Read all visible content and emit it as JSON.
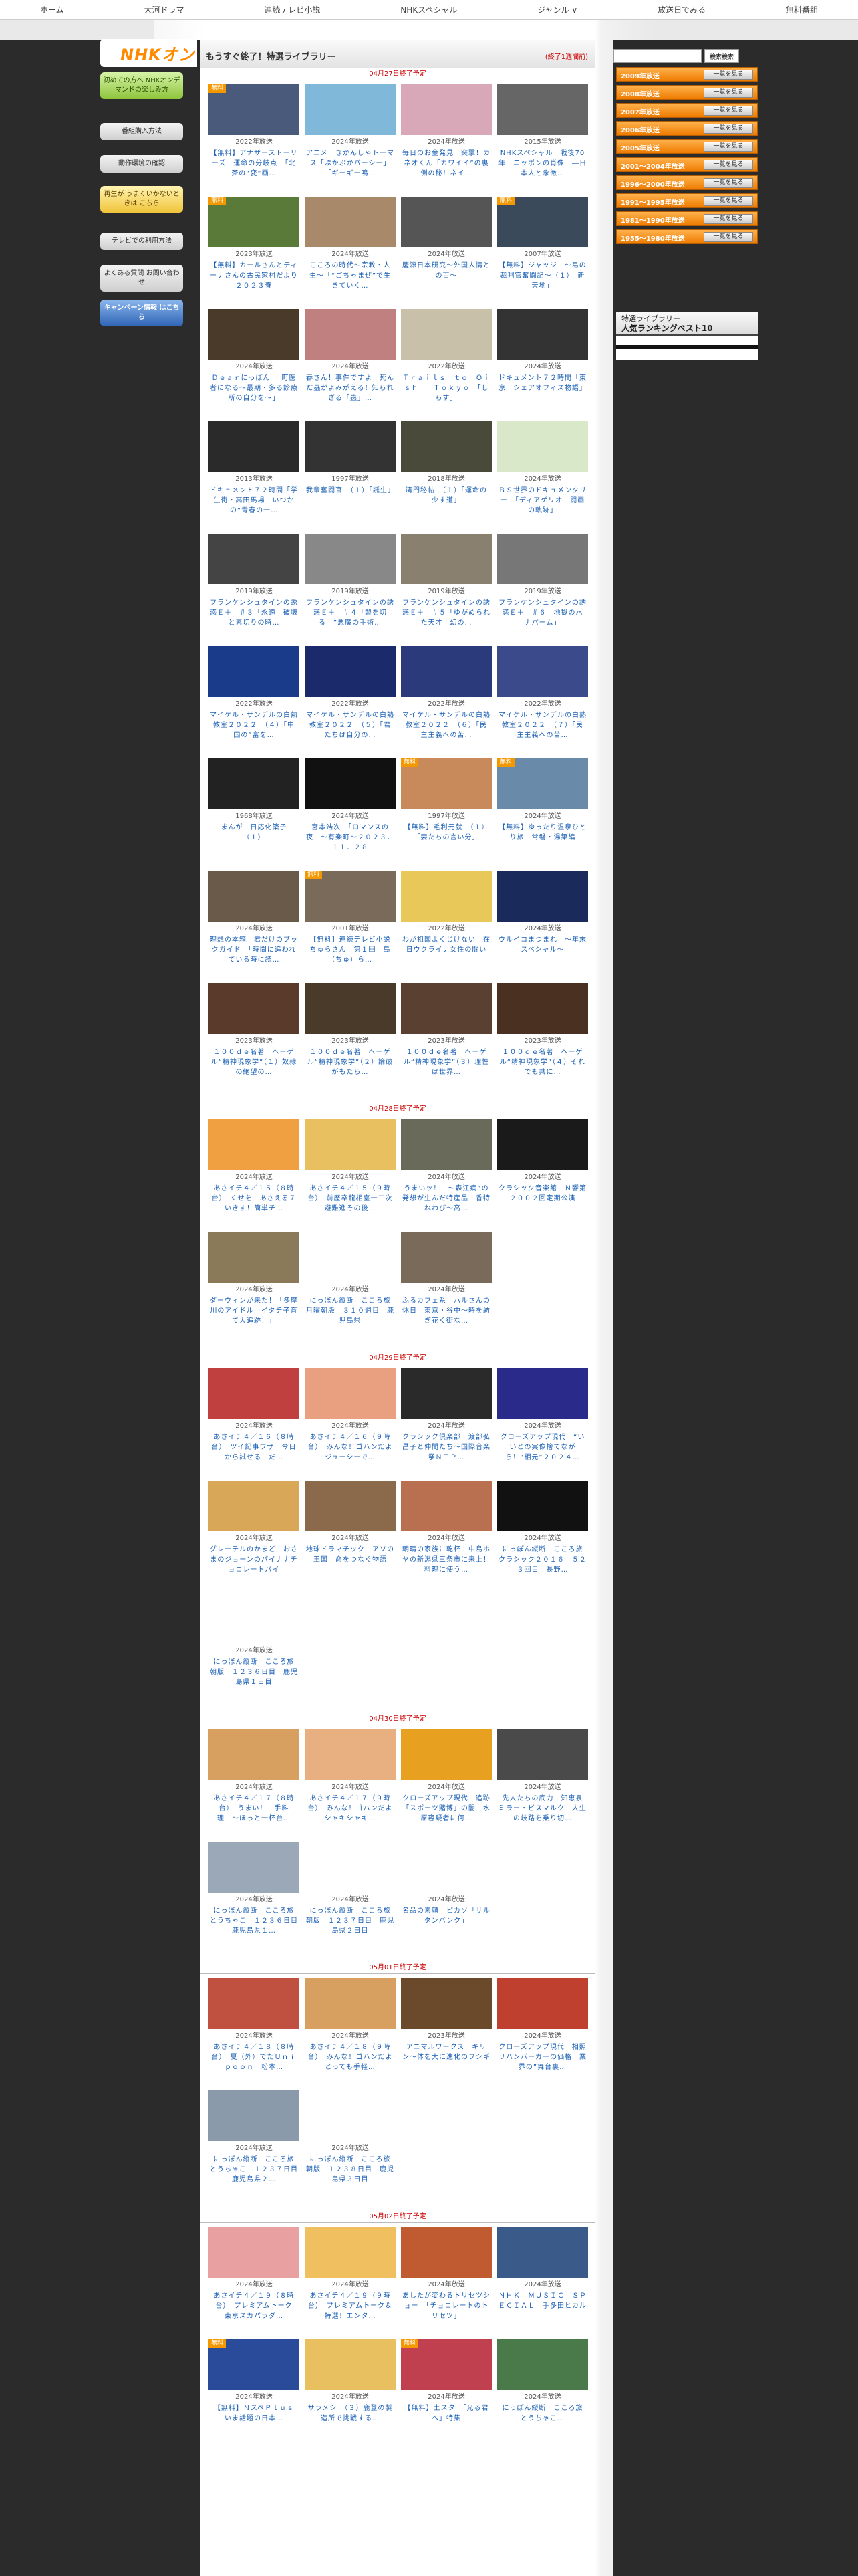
{
  "topnav": [
    "ホーム",
    "大河ドラマ",
    "連続テレビ小説",
    "NHKスペシャル",
    "ジャンル ∨",
    "放送日でみる",
    "無料番組"
  ],
  "logo": "NHKオン",
  "left_buttons": [
    "初めての方へ NHKオンデマンドの楽しみ方",
    "番組購入方法",
    "動作環境の確認",
    "再生が うまくいかないときは こちら",
    "テレビでの利用方法",
    "よくある質問 お問い合わせ",
    "キャンペーン情報 はこちら"
  ],
  "banner": {
    "title": "もうすぐ終了！特選ライブラリー",
    "note": "(終了1週間前)"
  },
  "search": {
    "placeholder": "",
    "button": "検索検索"
  },
  "years": [
    {
      "label": "2009年放送",
      "btn": "一覧を見る"
    },
    {
      "label": "2008年放送",
      "btn": "一覧を見る"
    },
    {
      "label": "2007年放送",
      "btn": "一覧を見る"
    },
    {
      "label": "2006年放送",
      "btn": "一覧を見る"
    },
    {
      "label": "2005年放送",
      "btn": "一覧を見る"
    },
    {
      "label": "2001〜2004年放送",
      "btn": "一覧を見る"
    },
    {
      "label": "1996〜2000年放送",
      "btn": "一覧を見る"
    },
    {
      "label": "1991〜1995年放送",
      "btn": "一覧を見る"
    },
    {
      "label": "1981〜1990年放送",
      "btn": "一覧を見る"
    },
    {
      "label": "1955〜1980年放送",
      "btn": "一覧を見る"
    }
  ],
  "ranking": {
    "line1": "特選ライブラリー",
    "line2": "人気ランキングベスト10"
  },
  "sections": [
    {
      "label": "04月27日終了予定",
      "items": [
        {
          "badge": "無料",
          "year": "2022年放送",
          "title": "【無料】アナザーストーリーズ　運命の分岐点　「北斎の“変”画…",
          "bg": "#4a5a7a"
        },
        {
          "badge": "",
          "year": "2024年放送",
          "title": "アニメ　きかんしゃトーマス「ぷかぷかパーシー」「ギーギー鳴…",
          "bg": "#7fb8d8"
        },
        {
          "badge": "",
          "year": "2024年放送",
          "title": "毎日のお金発見　突撃！カネオくん「カワイイ”の裏側の秘！ネイ…",
          "bg": "#d8a8b8"
        },
        {
          "badge": "",
          "year": "2015年放送",
          "title": "NHKスペシャル　戦後70年　ニッポンの肖像　―日本人と象徴…",
          "bg": "#666"
        },
        {
          "badge": "無料",
          "year": "2023年放送",
          "title": "【無料】カールさんとティーナさんの古民家村だより　２０２３春",
          "bg": "#5a7a3a"
        },
        {
          "badge": "",
          "year": "2024年放送",
          "title": "こころの時代〜宗教・人生〜「“ごちゃまぜ”で生きていく…",
          "bg": "#a88a6a"
        },
        {
          "badge": "",
          "year": "2024年放送",
          "title": "慶源日本研究〜外国人情との百〜",
          "bg": "#555"
        },
        {
          "badge": "無料",
          "year": "2007年放送",
          "title": "【無料】ジャッジ　〜島の裁判官奮闘記〜（１）「新天地」",
          "bg": "#3a4a5a"
        },
        {
          "badge": "",
          "year": "2024年放送",
          "title": "Ｄｅａｒにっぽん　「町医者になる〜最期・多る診療所の自分を〜」",
          "bg": "#4a3a2a"
        },
        {
          "badge": "",
          "year": "2024年放送",
          "title": "吞さん！事件ですよ　死んだ蟲がよみがえる！知られざる「蟲」…",
          "bg": "#c08080"
        },
        {
          "badge": "",
          "year": "2022年放送",
          "title": "Ｔｒａｉｌｓ　ｔｏ　Ｏｉｓｈｉ　Ｔｏｋｙｏ　「しらす」",
          "bg": "#c8c0a8"
        },
        {
          "badge": "",
          "year": "2024年放送",
          "title": "ドキュメント７２時間「東京　シェアオフィス物語」",
          "bg": "#333"
        },
        {
          "badge": "",
          "year": "2013年放送",
          "title": "ドキュメント７２時間「学生街・高田馬場　いつかの”青春の一…",
          "bg": "#2a2a2a"
        },
        {
          "badge": "",
          "year": "1997年放送",
          "title": "我輩奮闘官　（１）「誕生」",
          "bg": "#333"
        },
        {
          "badge": "",
          "year": "2018年放送",
          "title": "湾門秘帖　（１）「運命の少す道」",
          "bg": "#4a4a3a"
        },
        {
          "badge": "",
          "year": "2024年放送",
          "title": "ＢＳ世界のドキュメンタリー　「ディアゲリオ　闘画の軌跡」",
          "bg": "#d8e8c8"
        },
        {
          "badge": "",
          "year": "2019年放送",
          "title": "フランケンシュタインの誘惑Ｅ＋　＃３「永遠　破壊と素切りの時…",
          "bg": "#444"
        },
        {
          "badge": "",
          "year": "2019年放送",
          "title": "フランケンシュタインの誘惑Ｅ＋　＃４「製を切る　”悪魔の手術…",
          "bg": "#888"
        },
        {
          "badge": "",
          "year": "2019年放送",
          "title": "フランケンシュタインの誘惑Ｅ＋　＃５「ゆがめられた天才　幻の…",
          "bg": "#8a8070"
        },
        {
          "badge": "",
          "year": "2019年放送",
          "title": "フランケンシュタインの誘惑Ｅ＋　＃６「地獄の水　ナパーム」",
          "bg": "#777"
        },
        {
          "badge": "",
          "year": "2022年放送",
          "title": "マイケル・サンデルの白熱教室２０２２　（４）「中国の”富を…",
          "bg": "#1a3a8a"
        },
        {
          "badge": "",
          "year": "2022年放送",
          "title": "マイケル・サンデルの白熱教室２０２２　（５）「君たちは自分の…",
          "bg": "#1a2a6a"
        },
        {
          "badge": "",
          "year": "2022年放送",
          "title": "マイケル・サンデルの白熱教室２０２２　（６）「民主主義への苦…",
          "bg": "#2a3a7a"
        },
        {
          "badge": "",
          "year": "2022年放送",
          "title": "マイケル・サンデルの白熱教室２０２２　（７）「民主主義への苦…",
          "bg": "#3a4a8a"
        },
        {
          "badge": "",
          "year": "1968年放送",
          "title": "まんが　日応化簗子　（１）",
          "bg": "#222"
        },
        {
          "badge": "",
          "year": "2024年放送",
          "title": "宮本浩次　「ロマンスの夜　〜有楽町〜２０２３．１１．２８",
          "bg": "#111"
        },
        {
          "badge": "無料",
          "year": "1997年放送",
          "title": "【無料】毛利元就　（１）「妻たちの言い分」",
          "bg": "#c88a5a"
        },
        {
          "badge": "無料",
          "year": "2024年放送",
          "title": "【無料】ゆったり温泉ひとり旅　常磐・湯築編",
          "bg": "#6a8aaa"
        },
        {
          "badge": "",
          "year": "2024年放送",
          "title": "理想の本箱　君だけのブックガイド　「時間に追われている時に読…",
          "bg": "#6a5a4a"
        },
        {
          "badge": "無料",
          "year": "2001年放送",
          "title": "【無料】連続テレビ小説　ちゅらさん　第１回　島（ちゅ）ら…",
          "bg": "#7a6a5a"
        },
        {
          "badge": "",
          "year": "2022年放送",
          "title": "わが祖国よくじけない　在日ウクライナ女性の闘い",
          "bg": "#e8c858"
        },
        {
          "badge": "",
          "year": "2024年放送",
          "title": "ウルイコまつまれ　〜年末スペシャル〜",
          "bg": "#1a2a5a"
        },
        {
          "badge": "",
          "year": "2023年放送",
          "title": "１００ｄｅ名著　ヘーゲル“精神現象学”（１）奴隷の絶望の…",
          "bg": "#5a3a2a"
        },
        {
          "badge": "",
          "year": "2023年放送",
          "title": "１００ｄｅ名著　ヘーゲル“精神現象学”（２）論破がもたら…",
          "bg": "#4a3a2a"
        },
        {
          "badge": "",
          "year": "2023年放送",
          "title": "１００ｄｅ名著　ヘーゲル“精神現象学”（３）理性は世界…",
          "bg": "#5a4030"
        },
        {
          "badge": "",
          "year": "2023年放送",
          "title": "１００ｄｅ名著　ヘーゲル“精神現象学”（４）それでも共に…",
          "bg": "#4a3020"
        }
      ]
    },
    {
      "label": "04月28日終了予定",
      "items": [
        {
          "badge": "",
          "year": "2024年放送",
          "title": "あさイチ４／１５（８時台）　くせを　あさえる７いきす！簡単チ…",
          "bg": "#f0a040"
        },
        {
          "badge": "",
          "year": "2024年放送",
          "title": "あさイチ４／１５（９時台）　前歴卒龍相臺一二次避難進その後…",
          "bg": "#e8c060"
        },
        {
          "badge": "",
          "year": "2024年放送",
          "title": "うまいッ！　〜森江病”の発想が生んだ特産品！香特ねわび〜高…",
          "bg": "#6a6a5a"
        },
        {
          "badge": "",
          "year": "2024年放送",
          "title": "クラシック音楽館　Ｎ響第２００２回定期公演",
          "bg": "#1a1a1a"
        },
        {
          "badge": "",
          "year": "2024年放送",
          "title": "ダーウィンが来た！「多摩川のアイドル　イタチ子育て大追跡！」",
          "bg": "#8a7a5a"
        },
        {
          "badge": "",
          "year": "2024年放送",
          "title": "にっぽん縦断　こころ旅　月曜朝版　３１０週目　鹿児島県",
          "bg": "#ffffff"
        },
        {
          "badge": "",
          "year": "2024年放送",
          "title": "ふるカフェ系　ハルさんの休日　東京・谷中〜時を紡ぎ花く街な…",
          "bg": "#7a6a5a"
        }
      ]
    },
    {
      "label": "04月29日終了予定",
      "items": [
        {
          "badge": "",
          "year": "2024年放送",
          "title": "あさイチ４／１６（８時台）　ツイ記事ワザ　今日から試せる！だ…",
          "bg": "#c04040"
        },
        {
          "badge": "",
          "year": "2024年放送",
          "title": "あさイチ４／１６（９時台）　みんな！ゴハンだよ　ジューシーで…",
          "bg": "#e8a080"
        },
        {
          "badge": "",
          "year": "2024年放送",
          "title": "クラシック倶楽部　渡部弘昌子と仲間たち〜国際音楽祭ＮＩＰ…",
          "bg": "#2a2a2a"
        },
        {
          "badge": "",
          "year": "2024年放送",
          "title": "クローズアップ現代　“いいとの実像捨てながら！”相元”２０２４…",
          "bg": "#2a2a8a"
        },
        {
          "badge": "",
          "year": "2024年放送",
          "title": "グレーテルのかまど　おさまのジョーンのパイナナチョコレートパイ",
          "bg": "#d8a858"
        },
        {
          "badge": "",
          "year": "2024年放送",
          "title": "地球ドラマチック　アソの王国　命をつなぐ物語",
          "bg": "#8a6a4a"
        },
        {
          "badge": "",
          "year": "2024年放送",
          "title": "朝晴の家族に乾杯　中島ホヤの新潟県三条市に来上！料理に使う…",
          "bg": "#b87050"
        },
        {
          "badge": "",
          "year": "2024年放送",
          "title": "にっぽん縦断　こころ旅　クラシック２０１６　５２３回目　長野…",
          "bg": "#111"
        },
        {
          "badge": "",
          "year": "2024年放送",
          "title": "にっぽん縦断　こころ旅　朝版　１２３６日目　鹿児島県１日目",
          "bg": "#ffffff"
        }
      ]
    },
    {
      "label": "04月30日終了予定",
      "items": [
        {
          "badge": "",
          "year": "2024年放送",
          "title": "あさイチ４／１７（８時台）　うまい！　手料理　〜ほっと一杯台…",
          "bg": "#d8a060"
        },
        {
          "badge": "",
          "year": "2024年放送",
          "title": "あさイチ４／１７（９時台）　みんな！ゴハンだよ　シャキシャキ…",
          "bg": "#e8b080"
        },
        {
          "badge": "",
          "year": "2024年放送",
          "title": "クローズアップ現代　追跡「スポーツ賭博」の闇　水原容疑者に何…",
          "bg": "#e8a020"
        },
        {
          "badge": "",
          "year": "2024年放送",
          "title": "先人たちの底力　知恵泉　ミラー・ビスマルク　人生の岐路を乗り切…",
          "bg": "#4a4a4a"
        },
        {
          "badge": "",
          "year": "2024年放送",
          "title": "にっぽん縦断　こころ旅　とうちゃこ　１２３６日目　鹿児島県１…",
          "bg": "#9aa8b8"
        },
        {
          "badge": "",
          "year": "2024年放送",
          "title": "にっぽん縦断　こころ旅　朝版　１２３７日目　鹿児島県２日目",
          "bg": "#ffffff"
        },
        {
          "badge": "",
          "year": "2024年放送",
          "title": "名品の素顔　ピカソ「サルタンバンク」",
          "bg": "#ffffff"
        }
      ]
    },
    {
      "label": "05月01日終了予定",
      "items": [
        {
          "badge": "",
          "year": "2024年放送",
          "title": "あさイチ４／１８（８時台）　夏（外）でたＵｎｉｐｏｏｎ　粉本…",
          "bg": "#c05040"
        },
        {
          "badge": "",
          "year": "2024年放送",
          "title": "あさイチ４／１８（９時台）　みんな！ゴハンだよ　とっても手軽…",
          "bg": "#d8a060"
        },
        {
          "badge": "",
          "year": "2023年放送",
          "title": "アニマルワークス　キリン〜体を大に進化のフシギ",
          "bg": "#6a4a2a"
        },
        {
          "badge": "",
          "year": "2024年放送",
          "title": "クローズアップ現代　相照リハンバーガーの価格　業界の”舞台裏…",
          "bg": "#c04030"
        },
        {
          "badge": "",
          "year": "2024年放送",
          "title": "にっぽん縦断　こころ旅　とうちゃこ　１２３７日目　鹿児島県２…",
          "bg": "#8a9aaa"
        },
        {
          "badge": "",
          "year": "2024年放送",
          "title": "にっぽん縦断　こころ旅　朝版　１２３８日目　鹿児島県３日目",
          "bg": "#ffffff"
        }
      ]
    },
    {
      "label": "05月02日終了予定",
      "items": [
        {
          "badge": "",
          "year": "2024年放送",
          "title": "あさイチ４／１９（８時台）　プレミアムトーク　東京スカパラダ…",
          "bg": "#e8a0a0"
        },
        {
          "badge": "",
          "year": "2024年放送",
          "title": "あさイチ４／１９（９時台）　プレミアムトーク＆特選！エンタ…",
          "bg": "#f0c060"
        },
        {
          "badge": "",
          "year": "2024年放送",
          "title": "あしたが変わるトリセツショー　「チョコレートのトリセツ」",
          "bg": "#c05a30"
        },
        {
          "badge": "",
          "year": "2024年放送",
          "title": "ＮＨＫ　ＭＵＳＩＣ　ＳＰＥＣＩＡＬ　手多田ヒカル",
          "bg": "#3a5a8a"
        },
        {
          "badge": "無料",
          "year": "2024年放送",
          "title": "【無料】ＮスペＰｌｕｓ　いま話題の日本…",
          "bg": "#2a4a9a"
        },
        {
          "badge": "",
          "year": "2024年放送",
          "title": "サラメシ　（３）鹿登の製造所で挑戦する…",
          "bg": "#e8c060"
        },
        {
          "badge": "無料",
          "year": "2024年放送",
          "title": "【無料】土スタ　「光る君へ」特集",
          "bg": "#c04050"
        },
        {
          "badge": "",
          "year": "2024年放送",
          "title": "にっぽん縦断　こころ旅　とうちゃこ…",
          "bg": "#4a7a4a"
        }
      ]
    }
  ]
}
